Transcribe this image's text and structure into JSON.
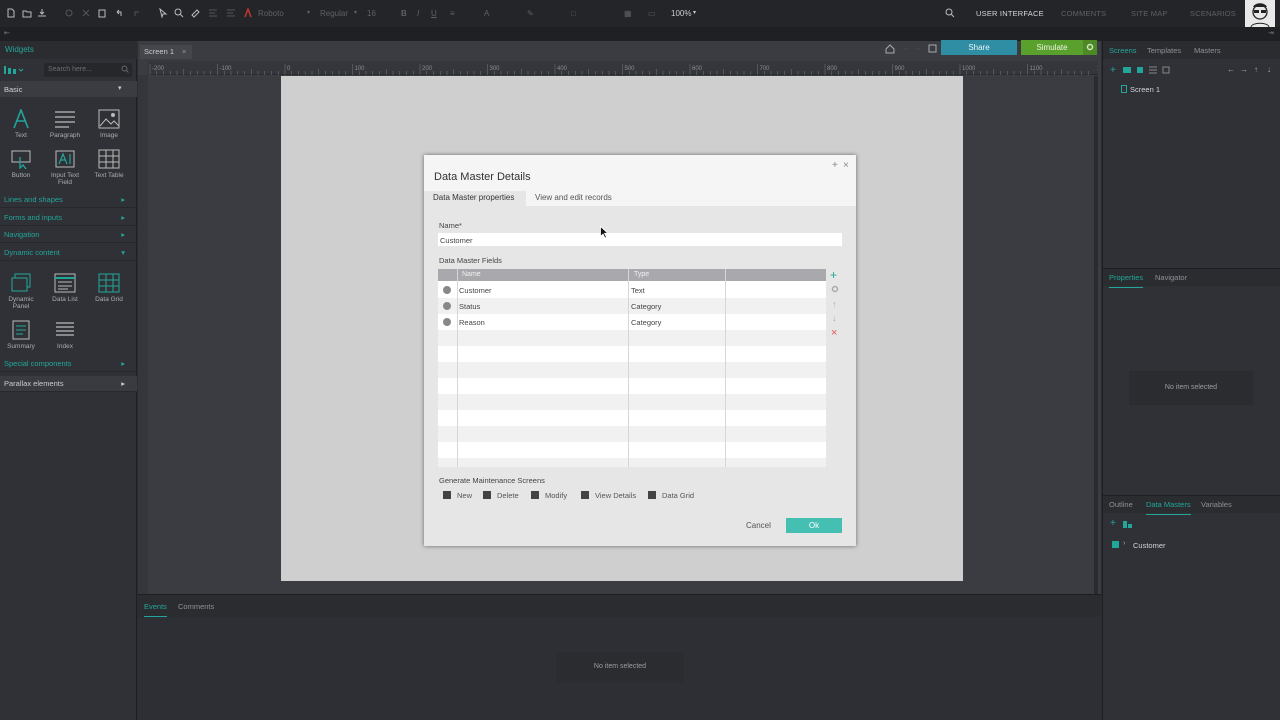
{
  "toolbar": {
    "font_name": "Roboto",
    "font_weight": "Regular",
    "font_size": "16",
    "zoom": "100%",
    "nav": [
      "USER INTERFACE",
      "COMMENTS",
      "SITE MAP",
      "SCENARIOS"
    ]
  },
  "left_panel": {
    "tab": "Widgets",
    "search_placeholder": "Search here...",
    "basic_label": "Basic",
    "basic_widgets": [
      "Text",
      "Paragraph",
      "Image",
      "Button",
      "Input Text Field",
      "Text Table"
    ],
    "sections_a": [
      "Lines and shapes",
      "Forms and inputs",
      "Navigation",
      "Dynamic content"
    ],
    "dynamic_widgets": [
      "Dynamic Panel",
      "Data List",
      "Data Grid",
      "Summary",
      "Index"
    ],
    "sections_b": [
      "Special components",
      "Parallax elements"
    ]
  },
  "canvas": {
    "screen_tab": "Screen 1",
    "share_label": "Share",
    "simulate_label": "Simulate",
    "ruler_labels": [
      "-200",
      "-100",
      "0",
      "100",
      "200",
      "300",
      "400",
      "500",
      "600",
      "700",
      "800",
      "900",
      "1000",
      "1100",
      "1200"
    ]
  },
  "bottom_panel": {
    "tabs": [
      "Events",
      "Comments"
    ],
    "empty_text": "No item selected"
  },
  "right_panel": {
    "top_tabs": [
      "Screens",
      "Templates",
      "Masters"
    ],
    "screen_item": "Screen 1",
    "mid_tabs": [
      "Properties",
      "Navigator"
    ],
    "empty_text": "No item selected",
    "bottom_tabs": [
      "Outline",
      "Data Masters",
      "Variables"
    ],
    "data_master_item": "Customer"
  },
  "dialog": {
    "title": "Data Master Details",
    "tabs": [
      "Data Master properties",
      "View and edit records"
    ],
    "name_label": "Name*",
    "name_value": "Customer",
    "fields_label": "Data Master Fields",
    "columns": [
      "Name",
      "Type"
    ],
    "rows": [
      {
        "name": "Customer",
        "type": "Text"
      },
      {
        "name": "Status",
        "type": "Category"
      },
      {
        "name": "Reason",
        "type": "Category"
      }
    ],
    "maintenance_label": "Generate Maintenance Screens",
    "checkboxes": [
      "New",
      "Delete",
      "Modify",
      "View Details",
      "Data Grid"
    ],
    "cancel_label": "Cancel",
    "ok_label": "Ok"
  },
  "colors": {
    "accent": "#23a69a",
    "simulate": "#5aa02c",
    "ok_button": "#46bfb3",
    "grid_header": "#a9a9ad",
    "delete_icon": "#e05a5a"
  }
}
